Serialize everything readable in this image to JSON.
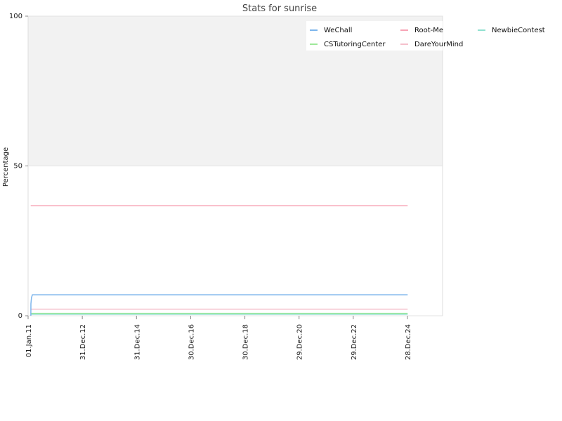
{
  "chart_data": {
    "type": "line",
    "title": "Stats for sunrise",
    "xlabel": "",
    "ylabel": "Percentage",
    "ylim": [
      0,
      100
    ],
    "xlim": [
      "2011-01-01",
      "2026-04-15"
    ],
    "yticks": [
      0,
      50,
      100
    ],
    "xticks": [
      {
        "label": "01.Jan.11",
        "date": "2011-01-01"
      },
      {
        "label": "31.Dec.12",
        "date": "2012-12-31"
      },
      {
        "label": "31.Dec.14",
        "date": "2014-12-31"
      },
      {
        "label": "30.Dec.16",
        "date": "2016-12-30"
      },
      {
        "label": "30.Dec.18",
        "date": "2018-12-30"
      },
      {
        "label": "29.Dec.20",
        "date": "2020-12-29"
      },
      {
        "label": "29.Dec.22",
        "date": "2022-12-29"
      },
      {
        "label": "28.Dec.24",
        "date": "2024-12-28"
      }
    ],
    "shaded_band": [
      50,
      100
    ],
    "legend_position": "top-right",
    "series": [
      {
        "name": "WeChall",
        "color": "#7cb5ec",
        "points": [
          [
            "2011-02-07",
            0
          ],
          [
            "2011-02-08",
            4
          ],
          [
            "2011-02-15",
            6
          ],
          [
            "2011-02-28",
            7
          ],
          [
            "2024-12-31",
            7
          ]
        ]
      },
      {
        "name": "Root-Me",
        "color": "#f7a3b5",
        "points": [
          [
            "2011-02-05",
            36.7
          ],
          [
            "2024-12-31",
            36.7
          ]
        ]
      },
      {
        "name": "NewbieContest",
        "color": "#90e0d0",
        "points": [
          [
            "2011-02-05",
            0.5
          ],
          [
            "2024-12-31",
            0.5
          ]
        ]
      },
      {
        "name": "CSTutoringCenter",
        "color": "#9ee89a",
        "points": [
          [
            "2011-02-05",
            0.8
          ],
          [
            "2024-12-31",
            0.8
          ]
        ]
      },
      {
        "name": "DareYourMind",
        "color": "#f5c0cc",
        "points": [
          [
            "2011-02-05",
            2.2
          ],
          [
            "2024-12-31",
            2.2
          ]
        ]
      }
    ]
  }
}
